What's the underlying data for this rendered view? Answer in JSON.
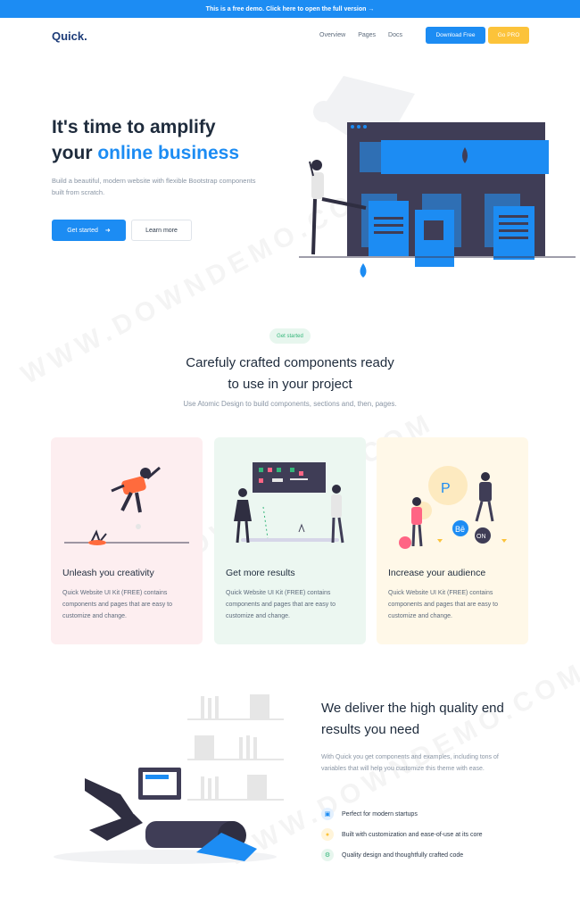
{
  "topbar": {
    "text": "This is a free demo. Click here to open the full version →"
  },
  "nav": {
    "logo": "Quick.",
    "links": [
      "Overview",
      "Pages",
      "Docs"
    ],
    "download": "Download Free",
    "pro": "Go PRO"
  },
  "hero": {
    "title_line1": "It's time to amplify",
    "title_prefix": "your ",
    "title_highlight": "online business",
    "subtitle": "Build a beautiful, modern website with flexible Bootstrap components built from scratch.",
    "primary_button": "Get started",
    "secondary_button": "Learn more"
  },
  "components": {
    "pill": "Get started",
    "title_line1": "Carefuly crafted components ready",
    "title_line2": "to use in your project",
    "subtitle": "Use Atomic Design to build components, sections and, then, pages.",
    "cards": [
      {
        "title": "Unleash you creativity",
        "text": "Quick Website UI Kit (FREE) contains components and pages that are easy to customize and change."
      },
      {
        "title": "Get more results",
        "text": "Quick Website UI Kit (FREE) contains components and pages that are easy to customize and change."
      },
      {
        "title": "Increase your audience",
        "text": "Quick Website UI Kit (FREE) contains components and pages that are easy to customize and change."
      }
    ]
  },
  "deliver": {
    "title_line1": "We deliver the high quality end",
    "title_line2": "results you need",
    "subtitle": "With Quick you get components and examples, including tons of variables that will help you customize this theme with ease.",
    "features": [
      {
        "icon": "building-icon",
        "label": "Perfect for modern startups"
      },
      {
        "icon": "lightbulb-icon",
        "label": "Built with customization and ease-of-use at its core"
      },
      {
        "icon": "gear-icon",
        "label": "Quality design and thoughtfully crafted code"
      }
    ]
  },
  "watermark": "WWW.DOWNDEMO.COM",
  "colors": {
    "primary": "#1c8cf3",
    "accent": "#fcc33a",
    "heading": "#1e2b3c"
  }
}
